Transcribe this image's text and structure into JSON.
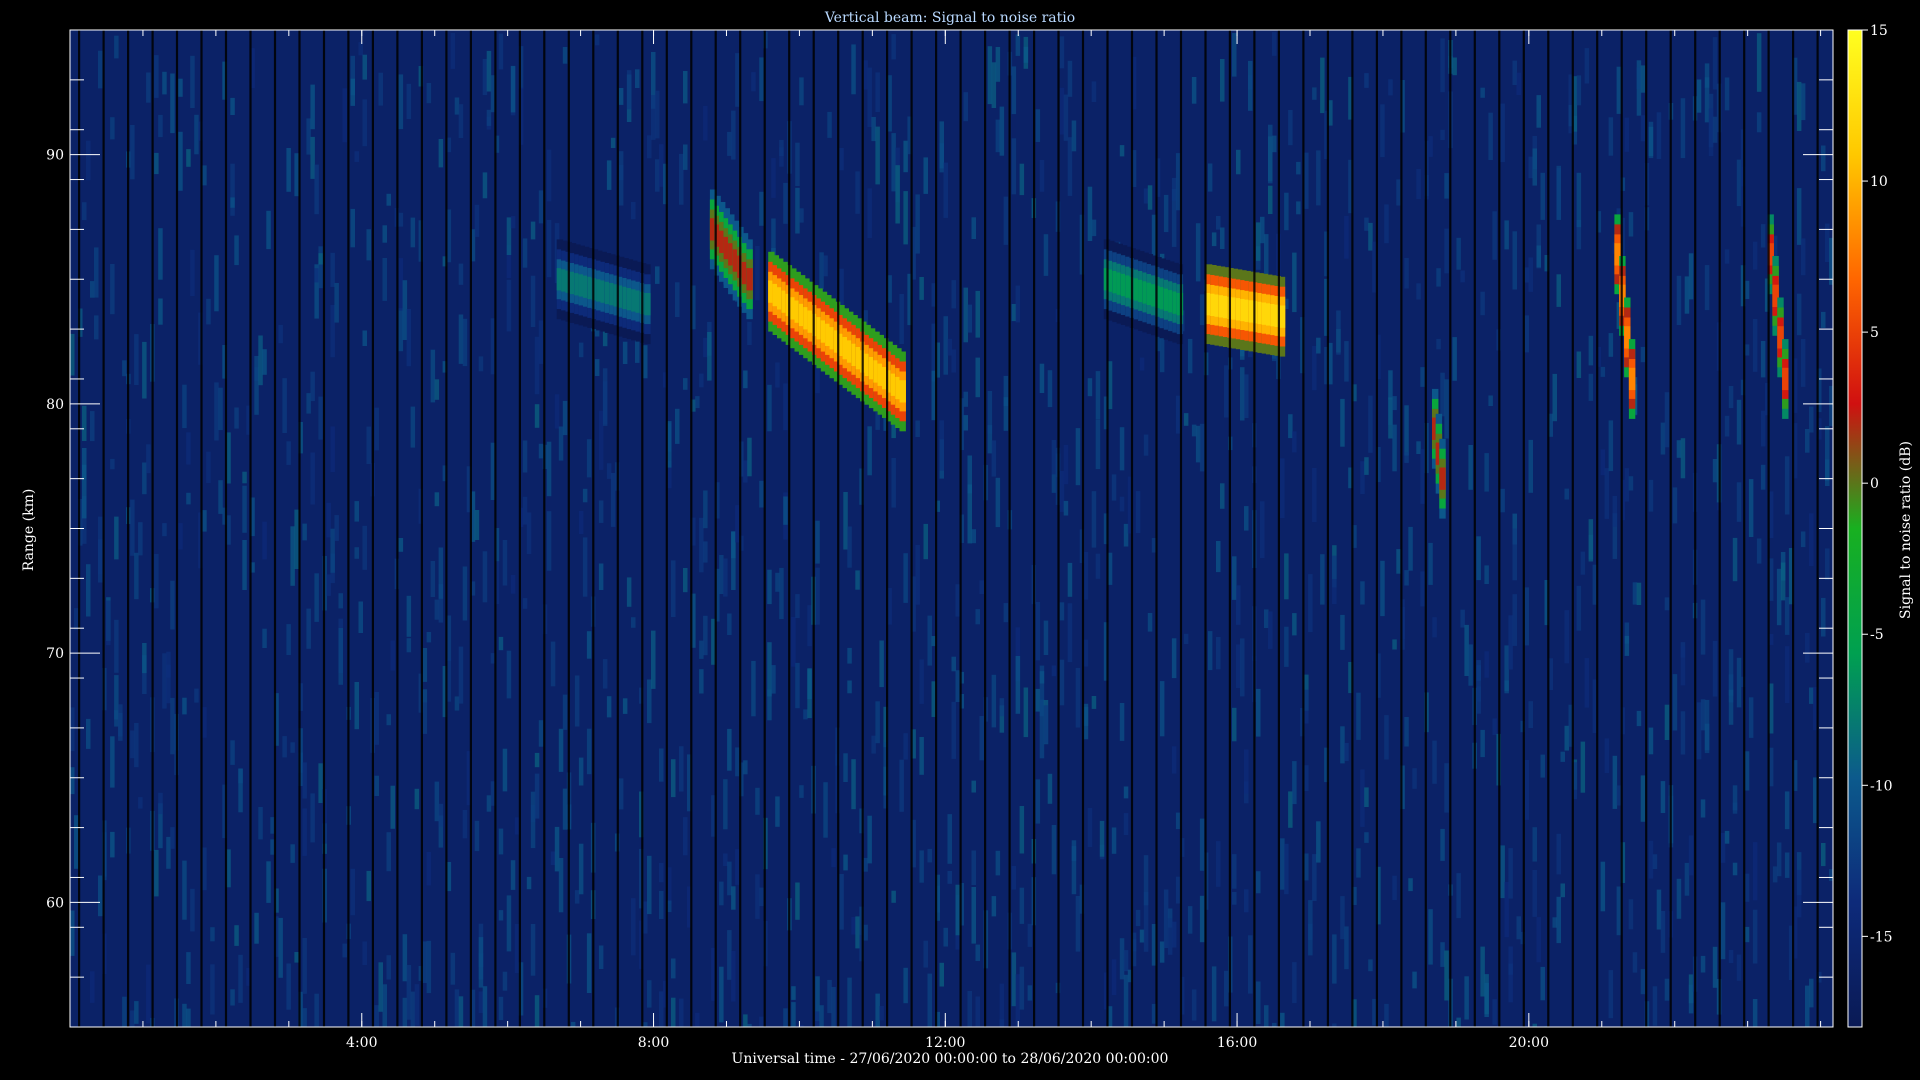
{
  "chart_data": {
    "type": "heatmap",
    "title": "Vertical beam: Signal to noise ratio",
    "xlabel": "Universal time - 27/06/2020 00:00:00 to 28/06/2020 00:00:00",
    "ylabel": "Range (km)",
    "x_unit": "hours UT",
    "xlim": [
      0,
      24.17
    ],
    "ylim": [
      55,
      95
    ],
    "x_ticks": [
      {
        "value": 4,
        "label": "4:00"
      },
      {
        "value": 8,
        "label": "8:00"
      },
      {
        "value": 12,
        "label": "12:00"
      },
      {
        "value": 16,
        "label": "16:00"
      },
      {
        "value": 20,
        "label": "20:00"
      }
    ],
    "y_ticks": [
      {
        "value": 60,
        "label": "60"
      },
      {
        "value": 70,
        "label": "70"
      },
      {
        "value": 80,
        "label": "80"
      },
      {
        "value": 90,
        "label": "90"
      }
    ],
    "colorbar": {
      "label": "Signal to noise ratio (dB)",
      "range": [
        -18,
        15
      ],
      "ticks": [
        {
          "value": -15,
          "label": "-15"
        },
        {
          "value": -10,
          "label": "-10"
        },
        {
          "value": -5,
          "label": "-5"
        },
        {
          "value": 0,
          "label": "0"
        },
        {
          "value": 5,
          "label": "5"
        },
        {
          "value": 10,
          "label": "10"
        },
        {
          "value": 15,
          "label": "15"
        }
      ],
      "colors": [
        "#0a1a55",
        "#0d2a7a",
        "#0c5a8c",
        "#00a050",
        "#18b020",
        "#d01010",
        "#ff6600",
        "#ffc800",
        "#ffff20"
      ]
    },
    "background_snr": -16,
    "features": [
      {
        "t_start": 9.6,
        "t_end": 11.4,
        "range_start": 84.5,
        "range_end": 80.5,
        "peak_snr": 11
      },
      {
        "t_start": 15.6,
        "t_end": 16.6,
        "range_start": 84.0,
        "range_end": 83.5,
        "peak_snr": 12
      },
      {
        "t_start": 21.2,
        "t_end": 21.4,
        "range_start": 86,
        "range_end": 81,
        "peak_snr": 8
      },
      {
        "t_start": 23.3,
        "t_end": 23.5,
        "range_start": 86,
        "range_end": 81,
        "peak_snr": 5
      },
      {
        "t_start": 8.8,
        "t_end": 9.3,
        "range_start": 87,
        "range_end": 85,
        "peak_snr": 2
      },
      {
        "t_start": 14.2,
        "t_end": 15.2,
        "range_start": 85,
        "range_end": 84,
        "peak_snr": -6
      },
      {
        "t_start": 6.7,
        "t_end": 7.9,
        "range_start": 85,
        "range_end": 84,
        "peak_snr": -8
      },
      {
        "t_start": 18.7,
        "t_end": 18.8,
        "range_start": 79,
        "range_end": 77,
        "peak_snr": 2
      }
    ]
  }
}
